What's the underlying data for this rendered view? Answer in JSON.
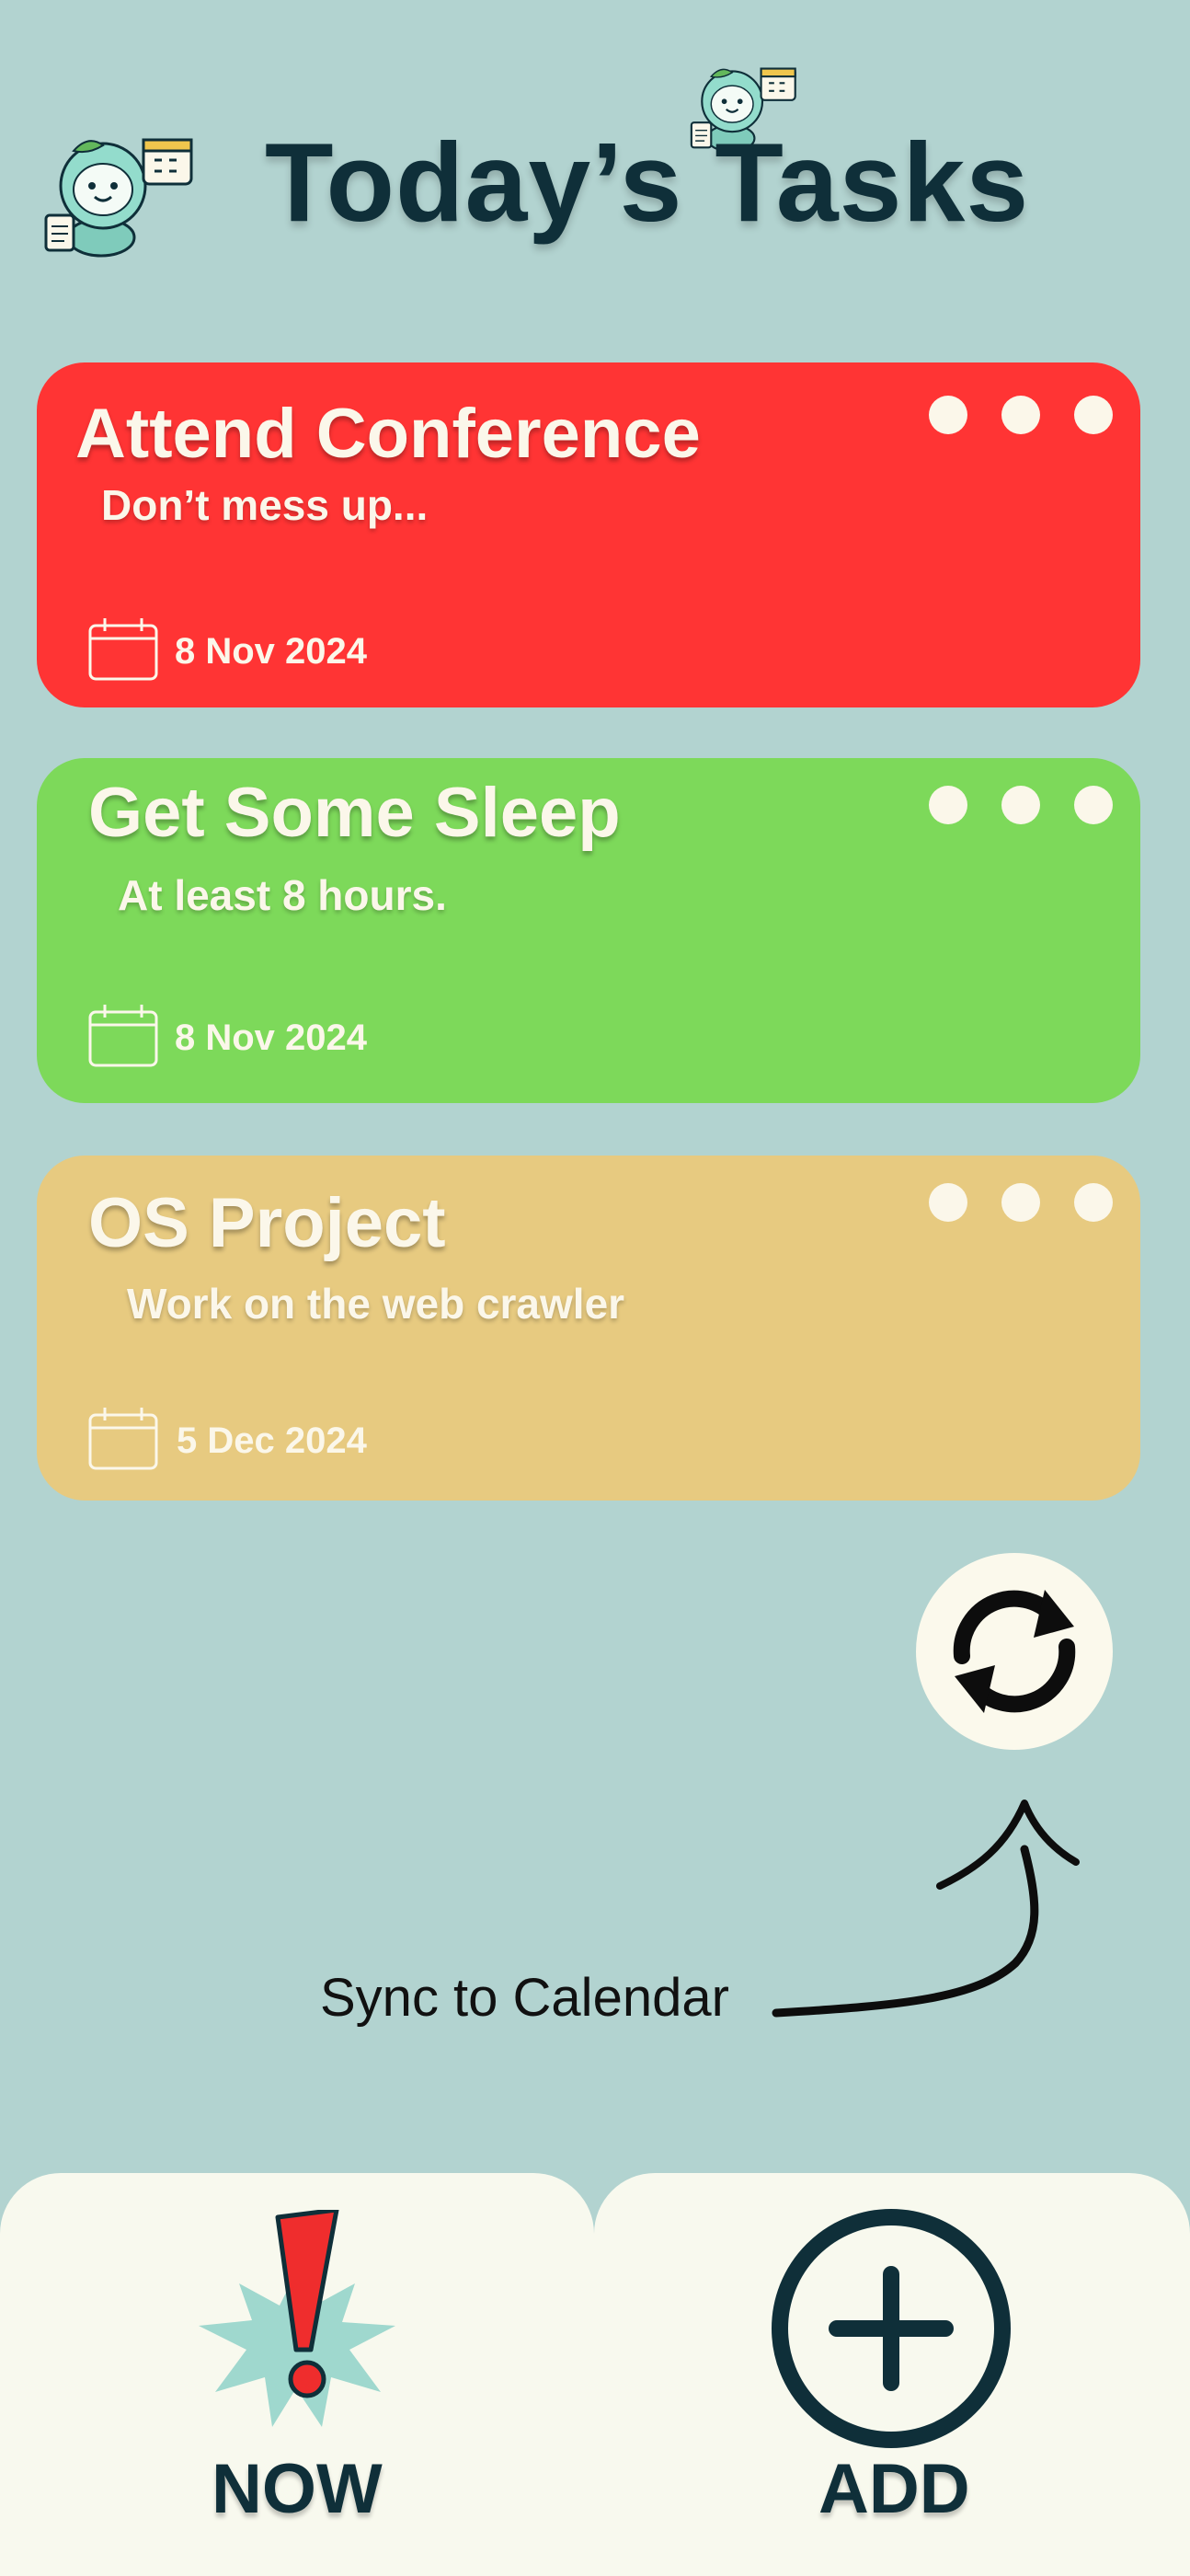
{
  "header": {
    "title": "Today’s Tasks",
    "mascot_icon": "mascot-calendar-icon"
  },
  "tasks": [
    {
      "title": "Attend Conference",
      "description": "Don’t mess up...",
      "date": "8 Nov 2024",
      "color": "#ff3434",
      "more_icon": "more-dots-icon",
      "calendar_icon": "calendar-icon"
    },
    {
      "title": "Get Some Sleep",
      "description": "At least 8 hours.",
      "date": "8 Nov 2024",
      "color": "#7dd95a",
      "more_icon": "more-dots-icon",
      "calendar_icon": "calendar-icon"
    },
    {
      "title": "OS Project",
      "description": "Work on the web crawler",
      "date": "5 Dec 2024",
      "color": "#e7ca80",
      "more_icon": "more-dots-icon",
      "calendar_icon": "calendar-icon"
    }
  ],
  "sync": {
    "label": "Sync to Calendar",
    "icon": "sync-icon",
    "arrow_icon": "curved-arrow-icon"
  },
  "bottom_nav": {
    "now_label": "NOW",
    "now_icon": "exclamation-burst-icon",
    "add_label": "ADD",
    "add_icon": "plus-circle-icon"
  },
  "colors": {
    "background": "#b2d3d0",
    "title": "#0f2f39",
    "card_text": "#fbf7ea",
    "nav_background": "#f8f9ee",
    "mascot": "#8fd9c9"
  }
}
